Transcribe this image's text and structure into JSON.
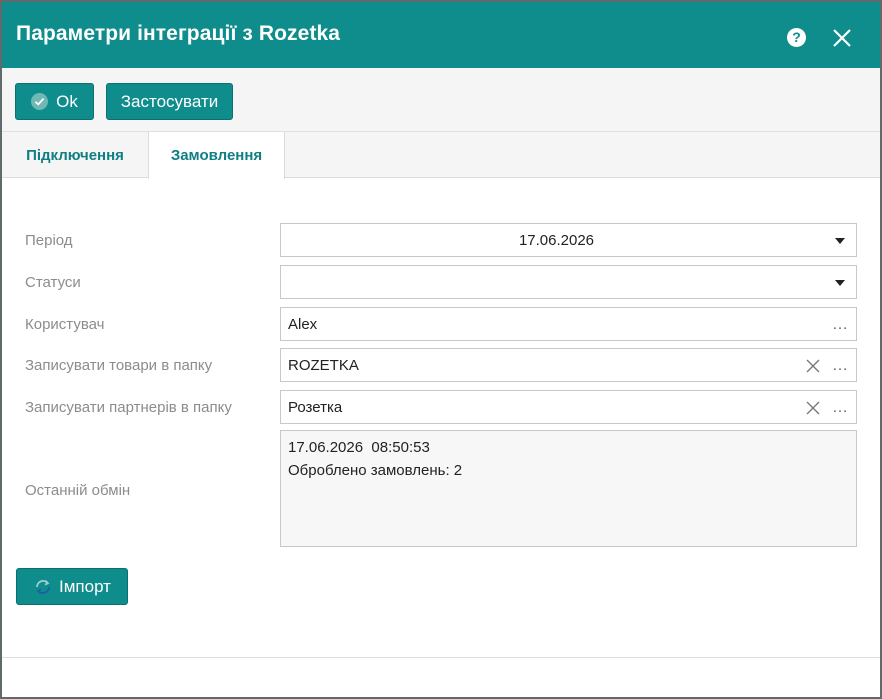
{
  "window": {
    "title": "Параметри інтеграції з Rozetka"
  },
  "toolbar": {
    "ok_label": "Ok",
    "apply_label": "Застосувати"
  },
  "tabs": [
    {
      "label": "Підключення"
    },
    {
      "label": "Замовлення",
      "active": true
    }
  ],
  "form": {
    "period": {
      "label": "Період",
      "value": "17.06.2026"
    },
    "statuses": {
      "label": "Статуси",
      "value": ""
    },
    "user": {
      "label": "Користувач",
      "value": "Alex"
    },
    "goods_folder": {
      "label": "Записувати товари в папку",
      "value": "ROZETKA"
    },
    "partners_folder": {
      "label": "Записувати партнерів в папку",
      "value": "Розетка"
    },
    "last_exchange": {
      "label": "Останній обмін",
      "line1": "17.06.2026  08:50:53",
      "line2": "Оброблено замовлень: 2"
    }
  },
  "actions": {
    "import_label": "Імпорт"
  },
  "colors": {
    "accent": "#0f8c8c",
    "label": "#8c8c8c"
  }
}
